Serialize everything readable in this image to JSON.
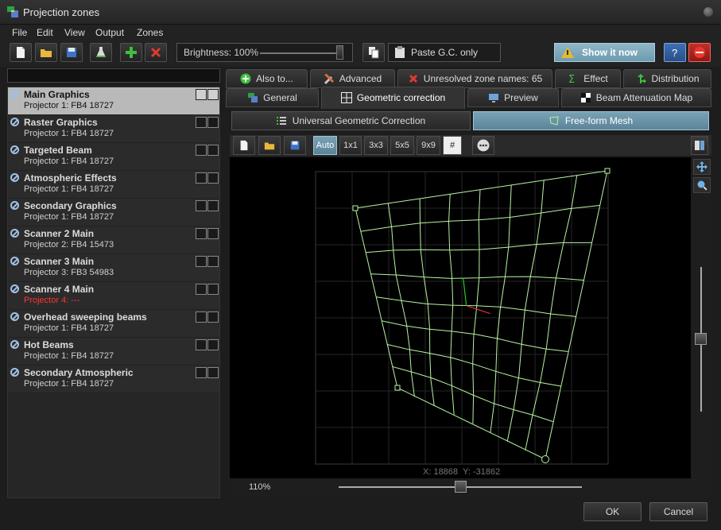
{
  "window": {
    "title": "Projection zones"
  },
  "menu": [
    "File",
    "Edit",
    "View",
    "Output",
    "Zones"
  ],
  "toolbar": {
    "brightness_label": "Brightness: 100%",
    "brightness_value": 1.0,
    "paste_label": "Paste G.C. only",
    "show_label": "Show it now"
  },
  "zones": [
    {
      "name": "Main Graphics",
      "projector": "Projector 1: FB4 18727",
      "selected": true,
      "error": false
    },
    {
      "name": "Raster Graphics",
      "projector": "Projector 1: FB4 18727",
      "selected": false,
      "error": false
    },
    {
      "name": "Targeted Beam",
      "projector": "Projector 1: FB4 18727",
      "selected": false,
      "error": false
    },
    {
      "name": "Atmospheric Effects",
      "projector": "Projector 1: FB4 18727",
      "selected": false,
      "error": false
    },
    {
      "name": "Secondary Graphics",
      "projector": "Projector 1: FB4 18727",
      "selected": false,
      "error": false
    },
    {
      "name": "Scanner 2 Main",
      "projector": "Projector 2: FB4 15473",
      "selected": false,
      "error": false
    },
    {
      "name": "Scanner 3 Main",
      "projector": "Projector 3: FB3 54983",
      "selected": false,
      "error": false
    },
    {
      "name": "Scanner 4 Main",
      "projector": "Projector 4: ---",
      "selected": false,
      "error": true
    },
    {
      "name": "Overhead sweeping beams",
      "projector": "Projector 1: FB4 18727",
      "selected": false,
      "error": false
    },
    {
      "name": "Hot Beams",
      "projector": "Projector 1: FB4 18727",
      "selected": false,
      "error": false
    },
    {
      "name": "Secondary Atmospheric",
      "projector": "Projector 1: FB4 18727",
      "selected": false,
      "error": false
    }
  ],
  "tabs_row1": [
    "Also to...",
    "Advanced",
    "Unresolved zone names: 65",
    "Effect",
    "Distribution"
  ],
  "tabs_row2": [
    "General",
    "Geometric correction",
    "Preview",
    "Beam Attenuation Map"
  ],
  "active_tab": "Geometric correction",
  "subtabs": [
    "Universal Geometric Correction",
    "Free-form Mesh"
  ],
  "active_subtab": "Free-form Mesh",
  "editor_buttons": [
    "Auto",
    "1x1",
    "3x3",
    "5x5",
    "9x9",
    "#"
  ],
  "active_editor_button": "Auto",
  "coords": {
    "x_label": "X: 18868",
    "y_label": "Y: -31862"
  },
  "zoom_label": "110%",
  "zoom_value": 0.5,
  "dialog": {
    "ok": "OK",
    "cancel": "Cancel"
  },
  "colors": {
    "mesh": "#b7f3a4",
    "accent": "#8fb7c8",
    "error": "#ff3333"
  }
}
